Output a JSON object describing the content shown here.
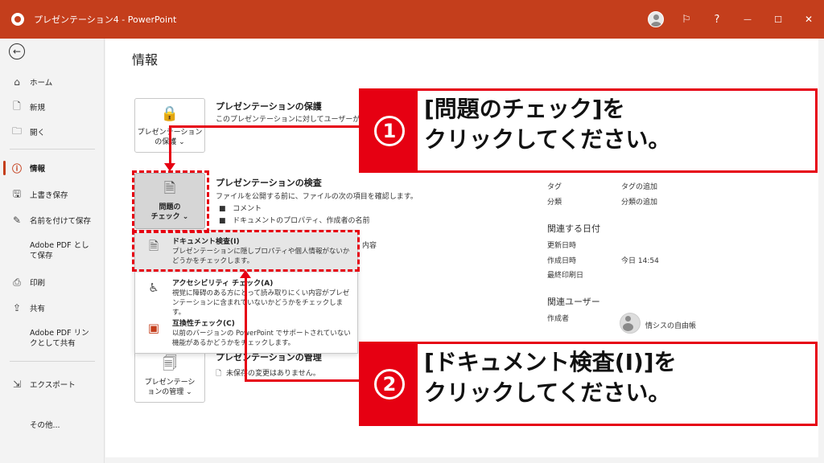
{
  "titlebar": {
    "title": "プレゼンテーション4  -  PowerPoint",
    "help": "?",
    "minimize": "—",
    "maximize": "☐",
    "close": "✕"
  },
  "sidebar": {
    "back": "←",
    "items": [
      {
        "label": "ホーム"
      },
      {
        "label": "新規"
      },
      {
        "label": "開く"
      },
      {
        "label": "情報"
      },
      {
        "label": "上書き保存"
      },
      {
        "label": "名前を付けて保存"
      },
      {
        "label": "Adobe PDF として保存"
      },
      {
        "label": "印刷"
      },
      {
        "label": "共有"
      },
      {
        "label": "Adobe PDF リンクとして共有"
      },
      {
        "label": "エクスポート"
      },
      {
        "label": "その他..."
      }
    ]
  },
  "main": {
    "title": "情報",
    "protect": {
      "button_line1": "プレゼンテーション",
      "button_line2": "の保護 ⌄",
      "heading": "プレゼンテーションの保護",
      "desc": "このプレゼンテーションに対してユーザーが行える..."
    },
    "inspect": {
      "button_line1": "問題の",
      "button_line2": "チェック ⌄",
      "heading": "プレゼンテーションの検査",
      "desc": "ファイルを公開する前に、ファイルの次の項目を確認します。",
      "bullet1": "コメント",
      "bullet2": "ドキュメントのプロパティ、作成者の名前",
      "bullet3_tail": "内容"
    },
    "manage": {
      "button_line1": "プレゼンテーシ",
      "button_line2": "ョンの管理 ⌄",
      "heading": "プレゼンテーションの管理",
      "desc": "未保存の変更はありません。"
    }
  },
  "dropdown": {
    "items": [
      {
        "title": "ドキュメント検査(I)",
        "desc": "プレゼンテーションに隠しプロパティや個人情報がないかどうかをチェックします。"
      },
      {
        "title": "アクセシビリティ チェック(A)",
        "desc": "視覚に障碍のある方にとって読み取りにくい内容がプレゼンテーションに含まれていないかどうかをチェックします。"
      },
      {
        "title": "互換性チェック(C)",
        "desc": "以前のバージョンの PowerPoint でサポートされていない機能があるかどうかをチェックします。"
      }
    ]
  },
  "properties": {
    "tag_label": "タグ",
    "tag_value": "タグの追加",
    "category_label": "分類",
    "category_value": "分類の追加",
    "dates_heading": "関連する日付",
    "updated_label": "更新日時",
    "created_label": "作成日時",
    "created_value": "今日 14:54",
    "printed_label": "最終印刷日",
    "users_heading": "関連ユーザー",
    "author_label": "作成者",
    "author_name": "情シスの自由帳"
  },
  "callouts": {
    "first_number": "1",
    "first_line1": "[問題のチェック]を",
    "first_line2": "クリックしてください。",
    "second_number": "2",
    "second_line1": "[ドキュメント検査(I)]を",
    "second_line2": "クリックしてください。",
    "accent": "#e60012"
  },
  "colors": {
    "titlebar": "#c43e1c",
    "highlight": "#e60012"
  }
}
